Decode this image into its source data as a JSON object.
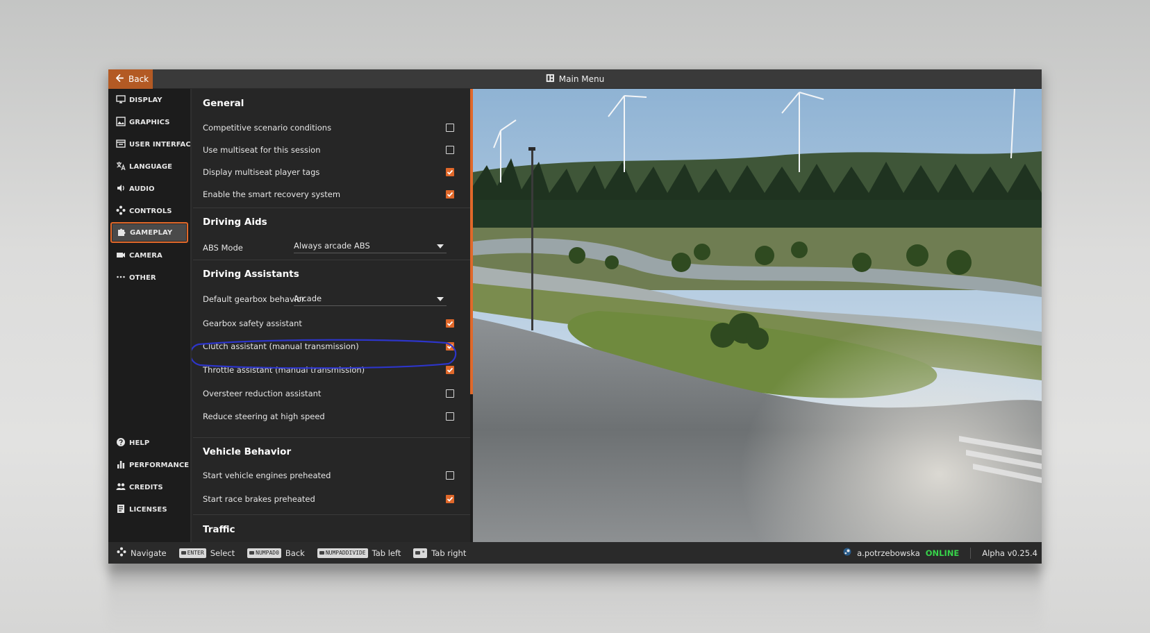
{
  "titlebar": {
    "back_label": "Back",
    "title": "Main Menu"
  },
  "sidebar": {
    "top_items": [
      {
        "label": "DISPLAY",
        "icon": "monitor-icon"
      },
      {
        "label": "GRAPHICS",
        "icon": "image-icon"
      },
      {
        "label": "USER INTERFACE",
        "icon": "window-icon"
      },
      {
        "label": "LANGUAGE",
        "icon": "translate-icon"
      },
      {
        "label": "AUDIO",
        "icon": "speaker-icon"
      },
      {
        "label": "CONTROLS",
        "icon": "dpad-icon"
      },
      {
        "label": "GAMEPLAY",
        "icon": "puzzle-icon",
        "active": true
      },
      {
        "label": "CAMERA",
        "icon": "camera-icon"
      },
      {
        "label": "OTHER",
        "icon": "ellipsis-icon"
      }
    ],
    "bottom_items": [
      {
        "label": "HELP",
        "icon": "question-icon"
      },
      {
        "label": "PERFORMANCE",
        "icon": "bar-chart-icon"
      },
      {
        "label": "CREDITS",
        "icon": "people-icon"
      },
      {
        "label": "LICENSES",
        "icon": "document-icon"
      }
    ]
  },
  "settings": {
    "general": {
      "title": "General",
      "rows": [
        {
          "label": "Competitive scenario conditions",
          "checked": false
        },
        {
          "label": "Use multiseat for this session",
          "checked": false
        },
        {
          "label": "Display multiseat player tags",
          "checked": true
        },
        {
          "label": "Enable the smart recovery system",
          "checked": true
        }
      ]
    },
    "driving_aids": {
      "title": "Driving Aids",
      "abs_label": "ABS Mode",
      "abs_value": "Always arcade ABS"
    },
    "driving_assistants": {
      "title": "Driving Assistants",
      "gearbox_label": "Default gearbox behavior",
      "gearbox_value": "Arcade",
      "rows": [
        {
          "label": "Gearbox safety assistant",
          "checked": true
        },
        {
          "label": "Clutch assistant (manual transmission)",
          "checked": true
        },
        {
          "label": "Throttle assistant (manual transmission)",
          "checked": true
        },
        {
          "label": "Oversteer reduction assistant",
          "checked": false
        },
        {
          "label": "Reduce steering at high speed",
          "checked": false
        }
      ]
    },
    "vehicle_behavior": {
      "title": "Vehicle Behavior",
      "rows": [
        {
          "label": "Start vehicle engines preheated",
          "checked": false
        },
        {
          "label": "Start race brakes preheated",
          "checked": true
        }
      ]
    },
    "traffic": {
      "title": "Traffic"
    }
  },
  "footer": {
    "hints": [
      {
        "key": "",
        "label": "Navigate"
      },
      {
        "key": "ENTER",
        "label": "Select"
      },
      {
        "key": "NUMPAD0",
        "label": "Back"
      },
      {
        "key": "NUMPADDIVIDE",
        "label": "Tab left"
      },
      {
        "key": "",
        "label": "Tab right"
      }
    ],
    "username": "a.potrzebowska",
    "status": "ONLINE",
    "version": "Alpha v0.25.4"
  },
  "colors": {
    "accent": "#e0682a",
    "back_button": "#b35a24",
    "online": "#37d24a",
    "annotation": "#2d35c9"
  }
}
